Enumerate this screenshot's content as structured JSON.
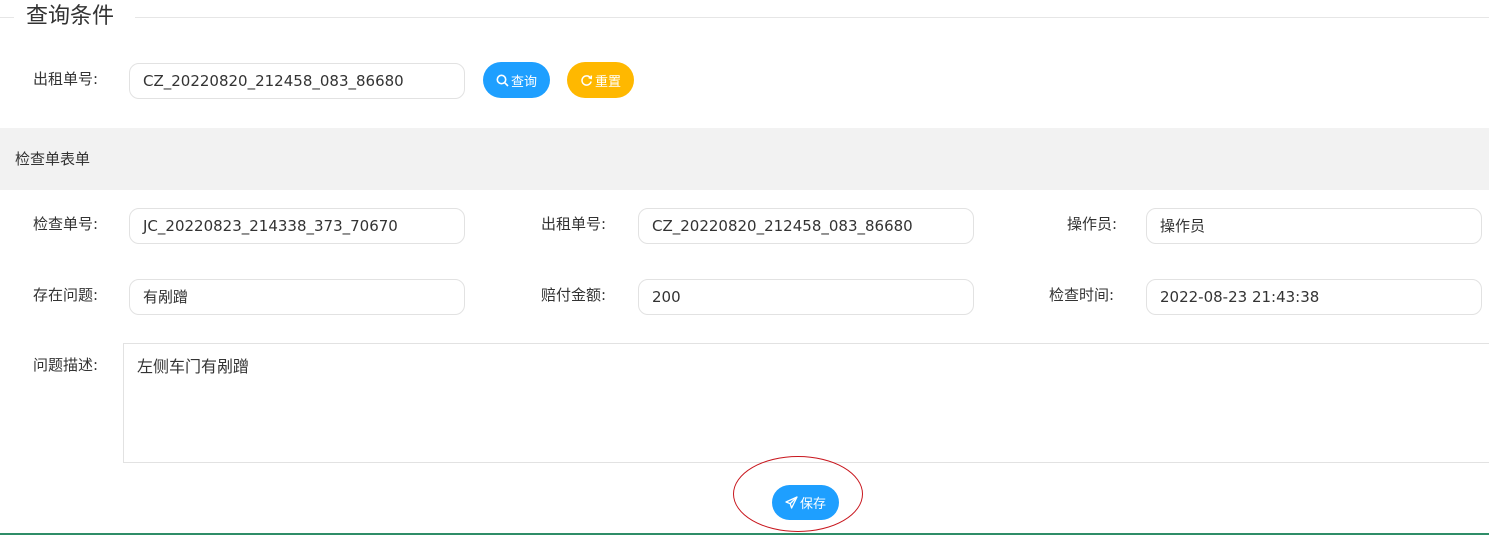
{
  "query": {
    "legend_title": "查询条件",
    "rental_no_label": "出租单号:",
    "rental_no_value": "CZ_20220820_212458_083_86680",
    "search_button": "查询",
    "reset_button": "重置"
  },
  "form": {
    "section_title": "检查单表单",
    "inspection_no_label": "检查单号:",
    "inspection_no_value": "JC_20220823_214338_373_70670",
    "rental_no_label": "出租单号:",
    "rental_no_value": "CZ_20220820_212458_083_86680",
    "operator_label": "操作员:",
    "operator_value": "操作员",
    "problem_label": "存在问题:",
    "problem_value": "有剐蹭",
    "compensation_label": "赔付金额:",
    "compensation_value": "200",
    "check_time_label": "检查时间:",
    "check_time_value": "2022-08-23 21:43:38",
    "description_label": "问题描述:",
    "description_value": "左侧车门有剐蹭",
    "save_button": "保存"
  },
  "colors": {
    "primary": "#1e9fff",
    "warning": "#ffb800",
    "annotation": "#c8161d",
    "section_bg": "#f2f2f2"
  },
  "icons": {
    "search": "search-icon",
    "reset": "refresh-icon",
    "save": "send-icon"
  }
}
